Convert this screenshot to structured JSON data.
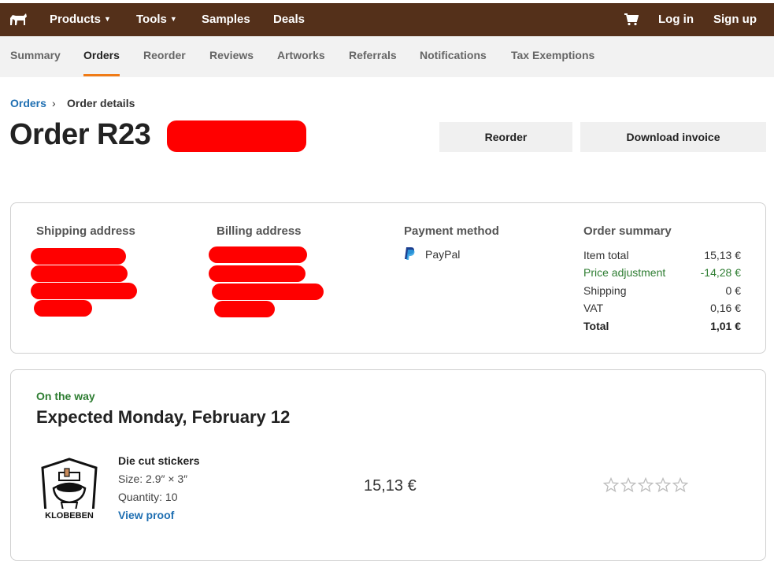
{
  "header": {
    "logo_icon": "horse-logo-icon",
    "nav": [
      {
        "label": "Products",
        "dropdown": true
      },
      {
        "label": "Tools",
        "dropdown": true
      },
      {
        "label": "Samples",
        "dropdown": false
      },
      {
        "label": "Deals",
        "dropdown": false
      }
    ],
    "cart_icon": "cart-icon",
    "login": "Log in",
    "signup": "Sign up",
    "bg_color": "#54301a"
  },
  "subnav": {
    "tabs": [
      "Summary",
      "Orders",
      "Reorder",
      "Reviews",
      "Artworks",
      "Referrals",
      "Notifications",
      "Tax Exemptions"
    ],
    "active": "Orders",
    "accent_color": "#f07b16"
  },
  "breadcrumb": {
    "link": "Orders",
    "separator": "›",
    "current": "Order details"
  },
  "order": {
    "title": "Order R23",
    "reorder_button": "Reorder",
    "invoice_button": "Download invoice"
  },
  "details": {
    "shipping_heading": "Shipping address",
    "billing_heading": "Billing address",
    "payment_heading": "Payment method",
    "payment_method": "PayPal",
    "payment_icon": "paypal-icon",
    "summary_heading": "Order summary",
    "summary": [
      {
        "label": "Item total",
        "value": "15,13 €"
      },
      {
        "label": "Price adjustment",
        "value": "-14,28 €"
      },
      {
        "label": "Shipping",
        "value": "0 €"
      },
      {
        "label": "VAT",
        "value": "0,16 €"
      },
      {
        "label": "Total",
        "value": "1,01 €"
      }
    ]
  },
  "shipment": {
    "status": "On the way",
    "expected": "Expected Monday, February 12",
    "item": {
      "name": "Die cut stickers",
      "size": "Size: 2.9″ × 3″",
      "quantity": "Quantity: 10",
      "proof_link": "View proof",
      "price": "15,13 €",
      "thumbnail_text": "KLOBEBEN",
      "rating_max": 5
    }
  },
  "colors": {
    "link": "#1f6fb2",
    "success": "#2e7d32",
    "redaction": "#ff0000"
  }
}
